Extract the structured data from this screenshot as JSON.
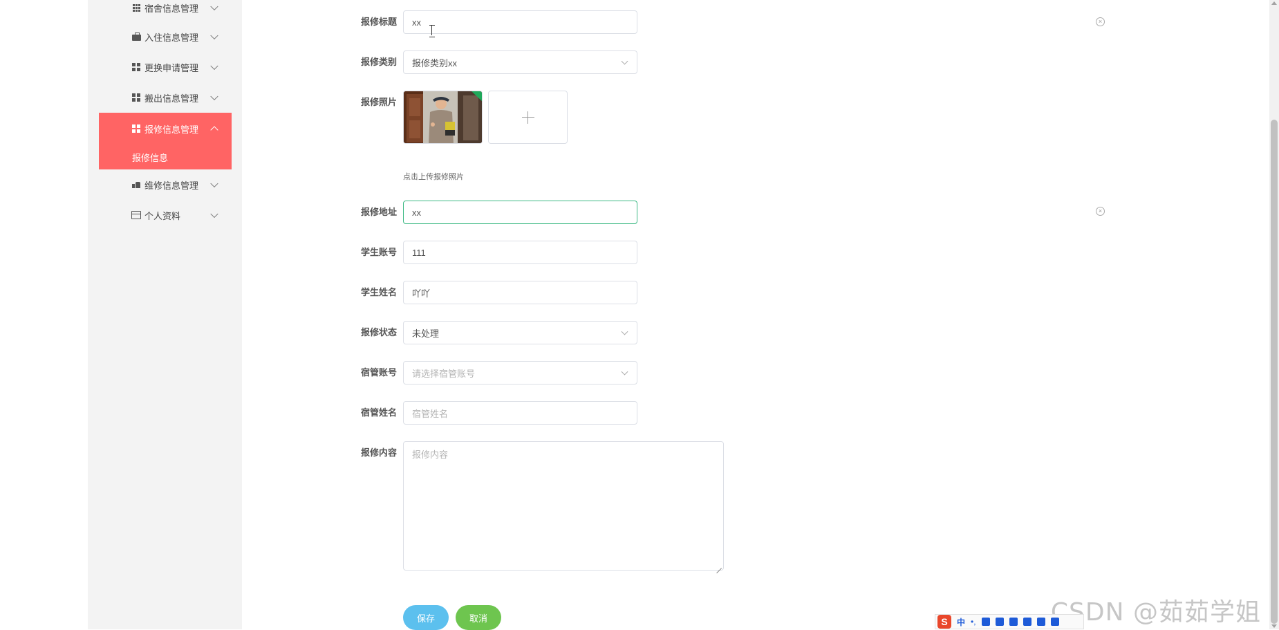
{
  "sidebar": {
    "items": [
      {
        "label": "宿舍信息管理",
        "icon": "grid-icon"
      },
      {
        "label": "入住信息管理",
        "icon": "briefcase-icon"
      },
      {
        "label": "更换申请管理",
        "icon": "grid-icon"
      },
      {
        "label": "搬出信息管理",
        "icon": "grid-icon"
      },
      {
        "label": "报修信息管理",
        "icon": "grid-icon",
        "active": true
      },
      {
        "label": "维修信息管理",
        "icon": "thumb-icon"
      },
      {
        "label": "个人资料",
        "icon": "card-icon"
      }
    ],
    "active_sub_item": "报修信息"
  },
  "form": {
    "title": {
      "label": "报修标题",
      "value": "xx"
    },
    "category": {
      "label": "报修类别",
      "value": "报修类别xx"
    },
    "photo": {
      "label": "报修照片",
      "hint": "点击上传报修照片"
    },
    "address": {
      "label": "报修地址",
      "value": "xx"
    },
    "student_account": {
      "label": "学生账号",
      "value": "111"
    },
    "student_name": {
      "label": "学生姓名",
      "value": "吖吖"
    },
    "status": {
      "label": "报修状态",
      "value": "未处理"
    },
    "manager_account": {
      "label": "宿管账号",
      "placeholder": "请选择宿管账号"
    },
    "manager_name": {
      "label": "宿管姓名",
      "placeholder": "宿管姓名"
    },
    "content": {
      "label": "报修内容",
      "placeholder": "报修内容"
    }
  },
  "buttons": {
    "save": "保存",
    "cancel": "取消"
  },
  "ime": {
    "logo": "S",
    "lang": "中",
    "punct": "•,"
  },
  "watermark": "CSDN @茹茹学姐",
  "colors": {
    "accent": "#ff6464",
    "focus_border": "#3cb984",
    "save_button": "#5cc0ee",
    "cancel_button": "#6ec54f"
  }
}
